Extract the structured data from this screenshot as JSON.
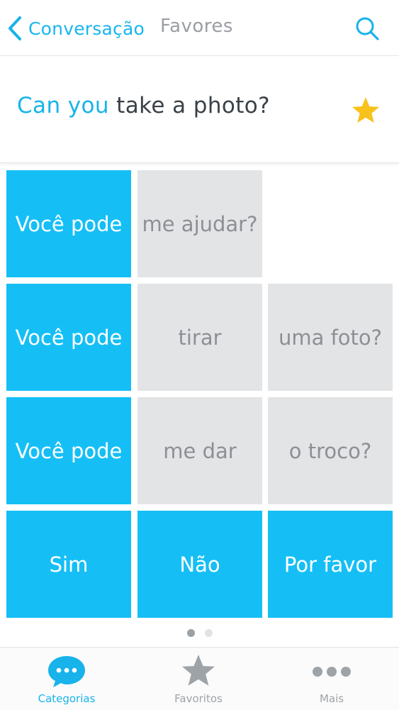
{
  "nav": {
    "back_label": "Conversação",
    "title": "Favores"
  },
  "phrase": {
    "highlight": "Can you",
    "rest": " take a photo?",
    "favorited": true
  },
  "grid": {
    "rows": [
      [
        "Você pode",
        "me ajudar?",
        ""
      ],
      [
        "Você pode",
        "tirar",
        "uma foto?"
      ],
      [
        "Você pode",
        "me dar",
        "o troco?"
      ],
      [
        "Sim",
        "Não",
        "Por favor"
      ]
    ]
  },
  "pager": {
    "pages": 2,
    "current": 1
  },
  "tabbar": {
    "tabs": [
      {
        "label": "Categorias",
        "icon": "chat-bubble-icon",
        "active": true
      },
      {
        "label": "Favoritos",
        "icon": "star-icon",
        "active": false
      },
      {
        "label": "Mais",
        "icon": "more-dots-icon",
        "active": false
      }
    ]
  },
  "colors": {
    "accent": "#17b3ea",
    "tile_blue": "#15bff5",
    "tile_gray": "#e3e4e6",
    "star": "#f8c21c"
  }
}
